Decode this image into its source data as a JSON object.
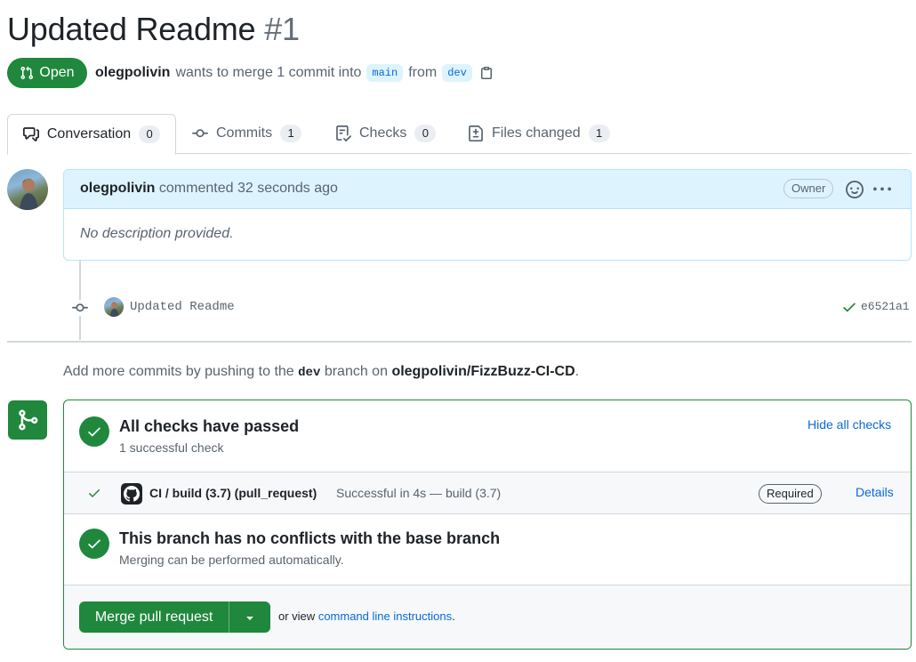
{
  "header": {
    "title": "Updated Readme",
    "number": "#1",
    "state": "Open",
    "author": "olegpolivin",
    "merge_text": "wants to merge 1 commit into",
    "base_branch": "main",
    "from_text": "from",
    "head_branch": "dev"
  },
  "tabs": [
    {
      "label": "Conversation",
      "count": "0",
      "icon": "comment-discussion-icon"
    },
    {
      "label": "Commits",
      "count": "1",
      "icon": "git-commit-icon"
    },
    {
      "label": "Checks",
      "count": "0",
      "icon": "checklist-icon"
    },
    {
      "label": "Files changed",
      "count": "1",
      "icon": "file-diff-icon"
    }
  ],
  "comment": {
    "author": "olegpolivin",
    "action": "commented 32 seconds ago",
    "role_badge": "Owner",
    "body": "No description provided."
  },
  "commit": {
    "message": "Updated Readme",
    "sha": "e6521a1"
  },
  "hint": {
    "prefix": "Add more commits by pushing to the",
    "branch": "dev",
    "middle": "branch on",
    "repo": "olegpolivin/FizzBuzz-CI-CD",
    "suffix": "."
  },
  "checks": {
    "title": "All checks have passed",
    "subtitle": "1 successful check",
    "toggle_label": "Hide all checks",
    "items": [
      {
        "name": "CI / build (3.7) (pull_request)",
        "status": "Successful in 4s — build (3.7)",
        "badge": "Required",
        "link": "Details"
      }
    ]
  },
  "conflicts": {
    "title": "This branch has no conflicts with the base branch",
    "subtitle": "Merging can be performed automatically."
  },
  "merge": {
    "button_label": "Merge pull request",
    "or_view": "or view",
    "link_label": "command line instructions",
    "suffix": "."
  },
  "colors": {
    "success": "#1f883d",
    "link": "#0969da",
    "muted": "#59636e",
    "comment_header_bg": "#ddf4ff"
  }
}
